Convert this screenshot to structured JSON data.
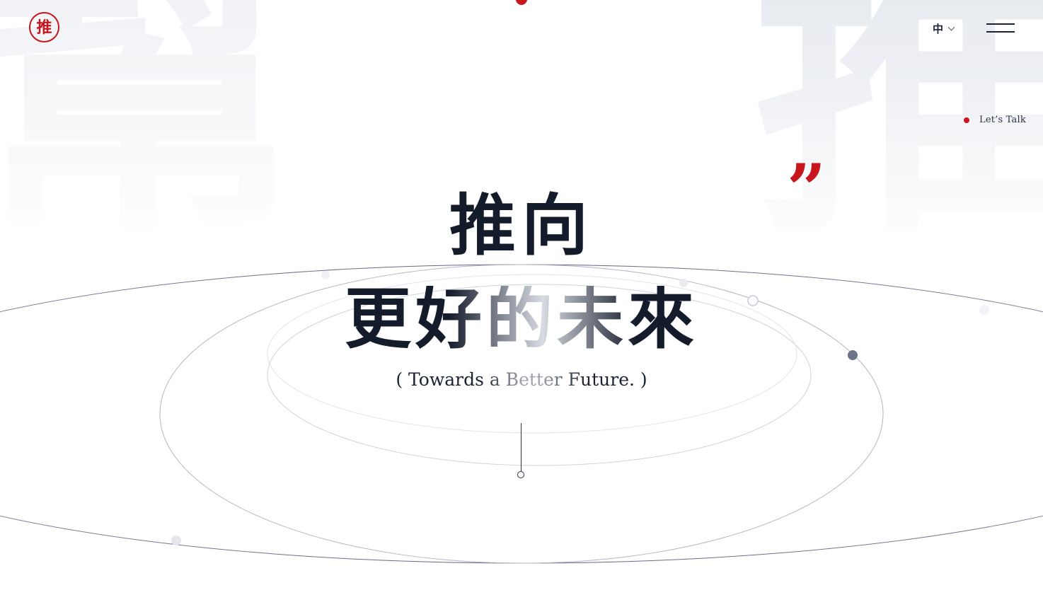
{
  "brand": {
    "logo_char": "推",
    "accent_color": "#c8161d",
    "text_color": "#141b2b"
  },
  "background": {
    "glyph_left": "幫",
    "glyph_right": "推"
  },
  "header": {
    "language_label": "中",
    "language_icon": "chevron-down-icon",
    "menu_icon": "hamburger-menu-icon"
  },
  "cta": {
    "talk_label": "Let’s Talk"
  },
  "hero": {
    "quote_mark": "”",
    "line1": "推向",
    "line2": "更好的未來",
    "subtitle": "( Towards a Better Future. )",
    "scroll_icon": "scroll-indicator-icon"
  }
}
